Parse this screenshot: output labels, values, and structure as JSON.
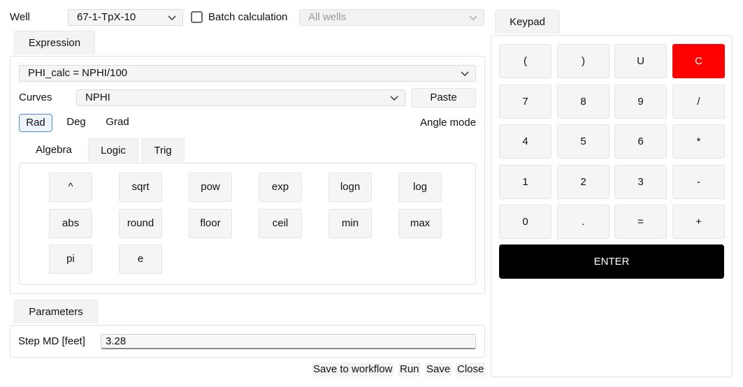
{
  "top": {
    "well_label": "Well",
    "well_value": "67-1-TpX-10",
    "batch_label": "Batch calculation",
    "batch_checked": false,
    "wells_placeholder": "All wells"
  },
  "expression": {
    "tab_label": "Expression",
    "expression_value": "PHI_calc = NPHI/100",
    "curves_label": "Curves",
    "curves_value": "NPHI",
    "paste_label": "Paste",
    "angle_modes": [
      "Rad",
      "Deg",
      "Grad"
    ],
    "angle_selected": "Rad",
    "angle_mode_label": "Angle mode",
    "subtabs": [
      "Algebra",
      "Logic",
      "Trig"
    ],
    "subtab_selected": "Algebra",
    "functions": [
      "^",
      "sqrt",
      "pow",
      "exp",
      "logn",
      "log",
      "abs",
      "round",
      "floor",
      "ceil",
      "min",
      "max",
      "pi",
      "e"
    ]
  },
  "parameters": {
    "tab_label": "Parameters",
    "step_label": "Step MD [feet]",
    "step_value": "3.28"
  },
  "footer": {
    "save_workflow": "Save to workflow",
    "run": "Run",
    "save": "Save",
    "close": "Close"
  },
  "keypad": {
    "tab_label": "Keypad",
    "keys": [
      "(",
      ")",
      "U",
      "C",
      "7",
      "8",
      "9",
      "/",
      "4",
      "5",
      "6",
      "*",
      "1",
      "2",
      "3",
      "-",
      "0",
      ".",
      "=",
      "+"
    ],
    "enter_label": "ENTER",
    "clear_color": "#ff0000"
  }
}
